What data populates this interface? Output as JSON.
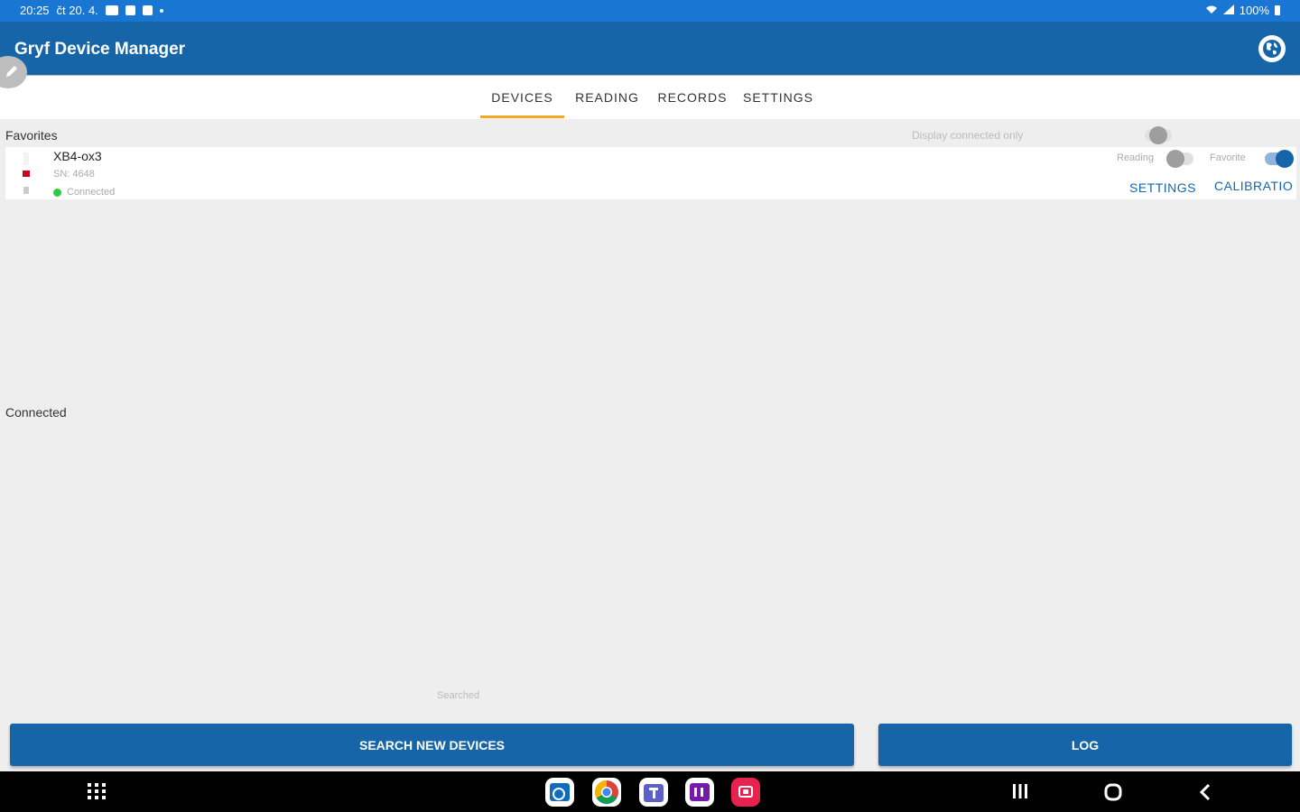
{
  "status_bar": {
    "time": "20:25",
    "date": "čt 20. 4.",
    "battery": "100%"
  },
  "app_bar": {
    "title": "Gryf Device Manager",
    "icon": "globe-icon"
  },
  "tabs": [
    {
      "label": "DEVICES",
      "selected": true
    },
    {
      "label": "READING",
      "selected": false
    },
    {
      "label": "RECORDS",
      "selected": false
    },
    {
      "label": "SETTINGS",
      "selected": false
    }
  ],
  "favorites": {
    "label": "Favorites",
    "display_connected_label": "Display connected only",
    "display_connected_on": false
  },
  "device": {
    "name": "XB4-ox3",
    "serial": "SN: 4648",
    "status": "Connected",
    "status_color": "#2ecc40",
    "reading_label": "Reading",
    "reading_on": false,
    "favorite_label": "Favorite",
    "favorite_on": true,
    "settings_button": "SETTINGS",
    "calibration_button": "CALIBRATIO"
  },
  "connected_section": {
    "label": "Connected"
  },
  "searched_label": "Searched",
  "buttons": {
    "search": "SEARCH NEW DEVICES",
    "log": "LOG"
  },
  "colors": {
    "primary": "#1565a8",
    "status_bar": "#1976d2",
    "accent": "#f5a623"
  },
  "dock_apps": [
    "outlook-icon",
    "chrome-icon",
    "teams-icon",
    "onenote-icon",
    "screen-recorder-icon"
  ]
}
